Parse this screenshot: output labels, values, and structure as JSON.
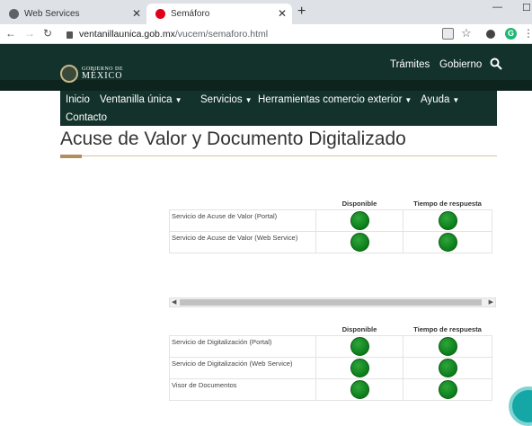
{
  "browser": {
    "tabs": [
      {
        "title": "Web Services"
      },
      {
        "title": "Semáforo"
      }
    ],
    "close_glyph": "✕",
    "new_tab_glyph": "+",
    "url_host": "ventanillaunica.gob.mx",
    "url_path": "/vucem/semaforo.html"
  },
  "site": {
    "logo_line1": "GOBIERNO DE",
    "logo_line2": "MÉXICO",
    "header_links": {
      "tramites": "Trámites",
      "gobierno": "Gobierno"
    },
    "nav": {
      "inicio": "Inicio",
      "ventanilla": "Ventanilla única",
      "servicios": "Servicios",
      "herramientas": "Herramientas comercio exterior",
      "ayuda": "Ayuda",
      "contacto": "Contacto"
    },
    "page_title": "Acuse de Valor y Documento Digitalizado",
    "status_color": "#0a7d1a"
  },
  "table1": {
    "headers": {
      "disponible": "Disponible",
      "respuesta": "Tiempo de respuesta"
    },
    "rows": [
      {
        "name": "Servicio de Acuse de Valor (Portal)"
      },
      {
        "name": "Servicio de Acuse de Valor (Web Service)"
      }
    ]
  },
  "table2": {
    "headers": {
      "disponible": "Disponible",
      "respuesta": "Tiempo de respuesta"
    },
    "rows": [
      {
        "name": "Servicio de Digitalización (Portal)"
      },
      {
        "name": "Servicio de Digitalización (Web Service)"
      },
      {
        "name": "Visor de Documentos"
      }
    ]
  }
}
